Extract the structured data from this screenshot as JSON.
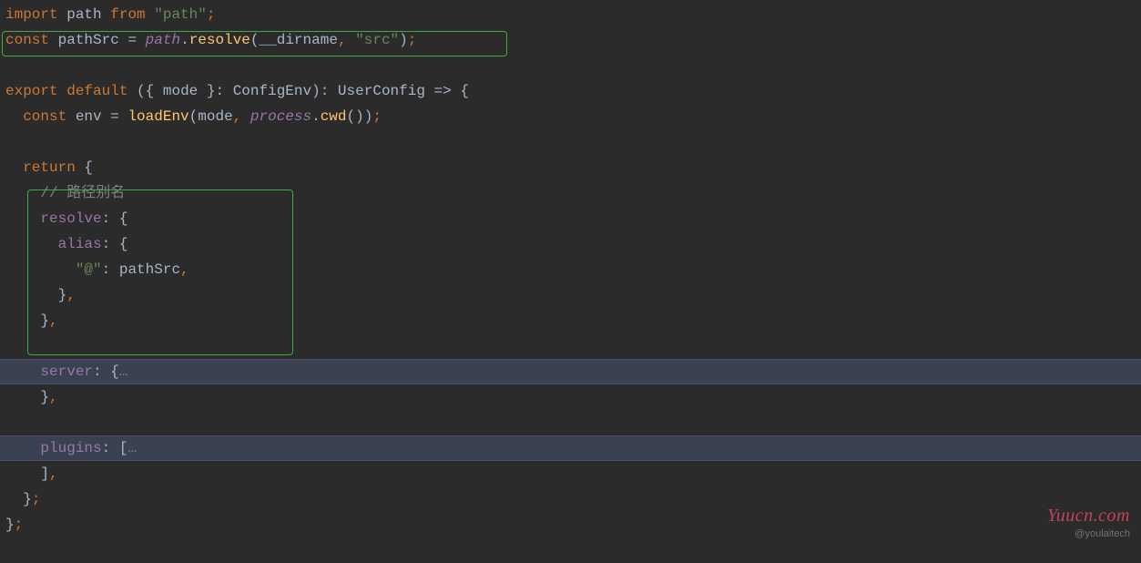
{
  "code": {
    "l1": {
      "import": "import",
      "path": "path",
      "from": "from",
      "pathStr": "\"path\"",
      "semi": ";"
    },
    "l2": {
      "const": "const",
      "pathSrc": "pathSrc",
      "eq": "=",
      "pathObj": "path",
      "dot": ".",
      "resolve": "resolve",
      "lp": "(",
      "dirname": "__dirname",
      "comma": ",",
      "srcStr": " \"src\"",
      "rp": ")",
      "semi": ";"
    },
    "l4": {
      "export": "export",
      "default": "default",
      "lp": "(",
      "lb": "{",
      "mode": " mode ",
      "rb": "}",
      "colon": ":",
      "configEnv": " ConfigEnv",
      "rp": ")",
      "colon2": ":",
      "userConfig": " UserConfig ",
      "arrow": "=>",
      "lb2": " {"
    },
    "l5": {
      "const": "  const",
      "env": " env ",
      "eq": "=",
      "loadEnv": " loadEnv",
      "lp": "(",
      "mode": "mode",
      "comma": ",",
      "process": " process",
      "dot": ".",
      "cwd": "cwd",
      "lp2": "(",
      "rp2": ")",
      "rp": ")",
      "semi": ";"
    },
    "l7": {
      "return": "  return",
      "lb": " {"
    },
    "l8": {
      "comment": "    // 路径别名"
    },
    "l9": {
      "resolve": "    resolve",
      "colon": ":",
      "lb": " {"
    },
    "l10": {
      "alias": "      alias",
      "colon": ":",
      "lb": " {"
    },
    "l11": {
      "atKey": "        \"@\"",
      "colon": ":",
      "pathSrc": " pathSrc",
      "comma": ","
    },
    "l12": {
      "rb": "      }",
      "comma": ","
    },
    "l13": {
      "rb": "    }",
      "comma": ","
    },
    "l15": {
      "server": "    server",
      "colon": ":",
      "lb": " {",
      "ellipsis": "…"
    },
    "l16": {
      "rb": "    }",
      "comma": ","
    },
    "l18": {
      "plugins": "    plugins",
      "colon": ":",
      "lb": " [",
      "ellipsis": "…"
    },
    "l19": {
      "rb": "    ]",
      "comma": ","
    },
    "l20": {
      "rb": "  }",
      "semi": ";"
    },
    "l21": {
      "rb": "}",
      "semi": ";"
    }
  },
  "watermarks": {
    "w1": "Yuucn.com",
    "w2": "@youlaitech"
  }
}
